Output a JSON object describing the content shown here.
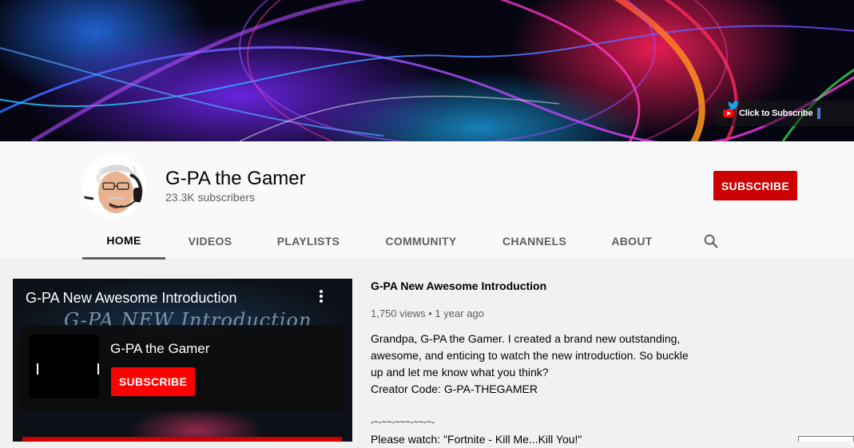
{
  "banner": {
    "link_label": "Click to Subscribe"
  },
  "channel": {
    "name": "G-PA the Gamer",
    "subscribers": "23.3K subscribers",
    "subscribe_label": "SUBSCRIBE"
  },
  "tabs": [
    {
      "label": "HOME",
      "active": true
    },
    {
      "label": "VIDEOS"
    },
    {
      "label": "PLAYLISTS"
    },
    {
      "label": "COMMUNITY"
    },
    {
      "label": "CHANNELS"
    },
    {
      "label": "ABOUT"
    }
  ],
  "featured": {
    "player_title": "G-PA New Awesome Introduction",
    "overlay_text": "G-PA  NEW Introduction",
    "endcard_name": "G-PA the Gamer",
    "endcard_subscribe": "SUBSCRIBE",
    "title": "G-PA New Awesome Introduction",
    "meta": "1,750 views • 1 year ago",
    "description": [
      "Grandpa, G-PA the Gamer. I created a brand new outstanding,",
      "awesome, and enticing to watch the new introduction. So buckle",
      "up and let me know what you think?",
      "Creator Code: G-PA-THEGAMER"
    ],
    "separator": "-~-~~-~~~-~~-~-",
    "watch_line": "Please watch: \"Fortnite - Kill Me...Kill You!\""
  },
  "colors": {
    "subscribe": "#cc0000",
    "endcard_subscribe": "#ff0000",
    "tab_active_underline": "#606060"
  }
}
